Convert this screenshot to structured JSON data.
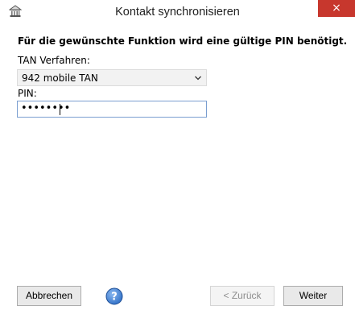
{
  "window": {
    "title": "Kontakt synchronisieren",
    "close_glyph": "×"
  },
  "icons": {
    "app": "bank-building-icon",
    "help": "help-icon",
    "dropdown": "chevron-down-icon"
  },
  "form": {
    "heading": "Für die gewünschte Funktion wird eine gültige PIN benötigt.",
    "tan_label": "TAN Verfahren:",
    "tan_selected": "942 mobile TAN",
    "pin_label": "PIN:",
    "pin_masked": "••••••••"
  },
  "buttons": {
    "cancel": "Abbrechen",
    "back": "< Zurück",
    "next": "Weiter"
  },
  "colors": {
    "close_button": "#c7372d",
    "input_focus_border": "#7a9ed0",
    "help_blue": "#2f6fc6"
  }
}
